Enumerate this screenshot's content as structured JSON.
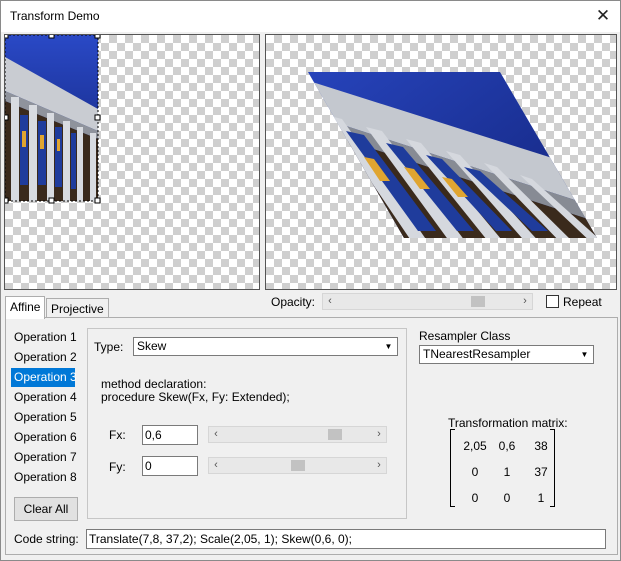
{
  "window": {
    "title": "Transform Demo"
  },
  "tabs": [
    {
      "label": "Affine",
      "active": true
    },
    {
      "label": "Projective",
      "active": false
    }
  ],
  "opacity": {
    "label": "Opacity:",
    "value": 0.8
  },
  "repeat": {
    "label": "Repeat",
    "checked": false
  },
  "operations": [
    "Operation 1",
    "Operation 2",
    "Operation 3",
    "Operation 4",
    "Operation 5",
    "Operation 6",
    "Operation 7",
    "Operation 8"
  ],
  "selected_operation": 2,
  "clear_all_label": "Clear All",
  "type": {
    "label": "Type:",
    "value": "Skew"
  },
  "method": {
    "heading": "method declaration:",
    "declaration": "procedure Skew(Fx, Fy: Extended);"
  },
  "fx": {
    "label": "Fx:",
    "value": "0,6",
    "slider": 0.78
  },
  "fy": {
    "label": "Fy:",
    "value": "0",
    "slider": 0.5
  },
  "resampler": {
    "label": "Resampler Class",
    "value": "TNearestResampler"
  },
  "matrix": {
    "label": "Transformation matrix:",
    "rows": [
      [
        "2,05",
        "0,6",
        "38"
      ],
      [
        "0",
        "1",
        "37"
      ],
      [
        "0",
        "0",
        "1"
      ]
    ]
  },
  "code": {
    "label": "Code string:",
    "value": "Translate(7,8, 37,2); Scale(2,05, 1); Skew(0,6, 0);"
  },
  "colors": {
    "selection": "#0078d7",
    "sky": "#1b2f9a",
    "stone": "#b8bcc4"
  },
  "icons": {
    "close": "close-icon",
    "dropdown": "chevron-down-icon",
    "left": "arrow-left-icon",
    "right": "arrow-right-icon"
  }
}
